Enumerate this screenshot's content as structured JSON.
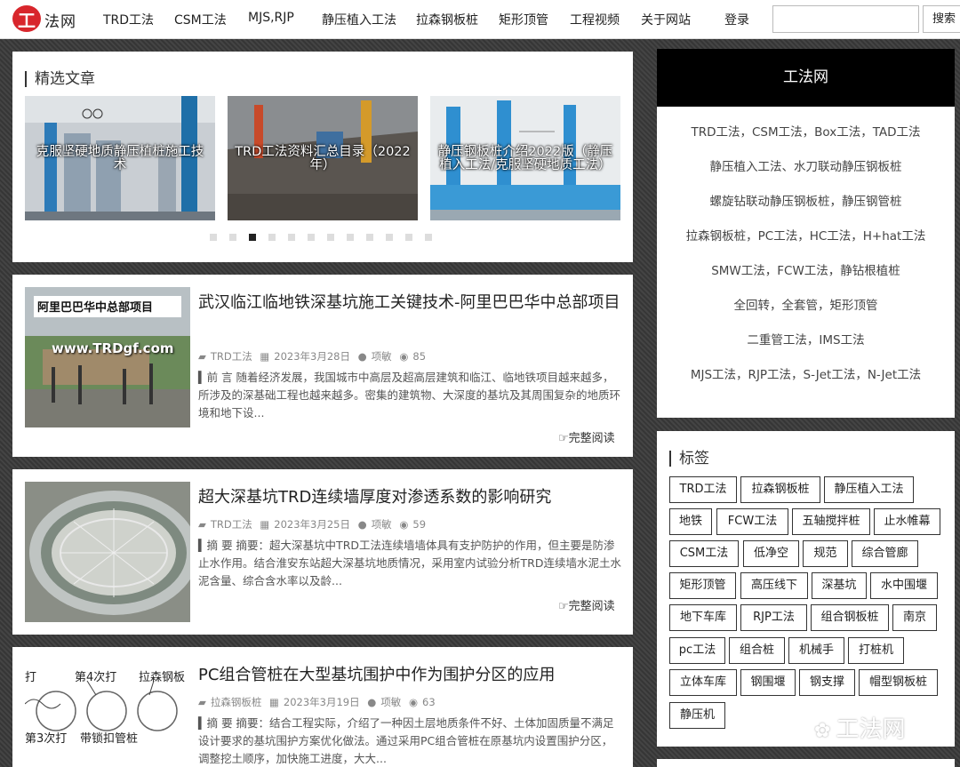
{
  "header": {
    "logo_mark": "工",
    "logo_text": "法网",
    "nav": [
      "TRD工法",
      "CSM工法",
      "MJS,RJP",
      "静压植入工法",
      "拉森钢板桩",
      "矩形顶管",
      "工程视频",
      "关于网站",
      "登录"
    ],
    "search": {
      "placeholder": "",
      "button_label": "搜索"
    }
  },
  "featured": {
    "title": "精选文章",
    "slides": [
      {
        "caption": "克服坚硬地质静压植桩施工技术"
      },
      {
        "caption": "TRD工法资料汇总目录（2022年）"
      },
      {
        "caption": "静压钢板桩介绍2022版（静压植入工法/克服坚硬地质工法）"
      }
    ],
    "dot_count": 12,
    "active_dot": 2
  },
  "articles": [
    {
      "title": "武汉临江临地铁深基坑施工关键技术-阿里巴巴华中总部项目",
      "category": "TRD工法",
      "date": "2023年3月28日",
      "author": "项敏",
      "views": "85",
      "excerpt": "▍前 言 随着经济发展，我国城市中高层及超高层建筑和临江、临地铁项目越来越多，所涉及的深基础工程也越来越多。密集的建筑物、大深度的基坑及其周围复杂的地质环境和地下设...",
      "thumb_text_1": "阿里巴巴华中总部项目",
      "thumb_text_2": "www.TRDgf.com",
      "read_more": "完整阅读"
    },
    {
      "title": "超大深基坑TRD连续墙厚度对渗透系数的影响研究",
      "category": "TRD工法",
      "date": "2023年3月25日",
      "author": "项敏",
      "views": "59",
      "excerpt": "▍摘 要 摘要：超大深基坑中TRD工法连续墙墙体具有支护防护的作用，但主要是防渗止水作用。结合淮安东站超大深基坑地质情况，采用室内试验分析TRD连续墙水泥土水泥含量、综合含水率以及龄...",
      "read_more": "完整阅读"
    },
    {
      "title": "PC组合管桩在大型基坑围护中作为围护分区的应用",
      "category": "拉森钢板桩",
      "date": "2023年3月19日",
      "author": "项敏",
      "views": "63",
      "excerpt": "▍摘 要  摘要：结合工程实际，介绍了一种因土层地质条件不好、土体加固质量不满足设计要求的基坑围护方案优化做法。通过采用PC组合管桩在原基坑内设置围护分区，调整挖土顺序，加快施工进度，大大...",
      "thumb_labels": [
        "打",
        "第4次打",
        "拉森钢板",
        "第3次打",
        "带锁扣管桩"
      ]
    }
  ],
  "sidebar": {
    "title": "工法网",
    "links": [
      "TRD工法，CSM工法，Box工法，TAD工法",
      "静压植入工法、水刀联动静压钢板桩",
      "螺旋钻联动静压钢板桩，静压钢管桩",
      "拉森钢板桩，PC工法，HC工法，H+hat工法",
      "SMW工法，FCW工法，静钻根植桩",
      "全回转，全套管，矩形顶管",
      "二重管工法，IMS工法",
      "MJS工法，RJP工法，S-Jet工法，N-Jet工法"
    ],
    "tags_title": "标签",
    "tags": [
      "TRD工法",
      "拉森钢板桩",
      "静压植入工法",
      "地铁",
      "FCW工法",
      "五轴搅拌桩",
      "止水帷幕",
      "CSM工法",
      "低净空",
      "规范",
      "综合管廊",
      "矩形顶管",
      "高压线下",
      "深基坑",
      "水中围堰",
      "地下车库",
      "RJP工法",
      "组合钢板桩",
      "南京",
      "pc工法",
      "组合桩",
      "机械手",
      "打桩机",
      "立体车库",
      "钢围堰",
      "钢支撑",
      "帽型钢板桩",
      "静压机"
    ],
    "watermark": "工法网"
  }
}
